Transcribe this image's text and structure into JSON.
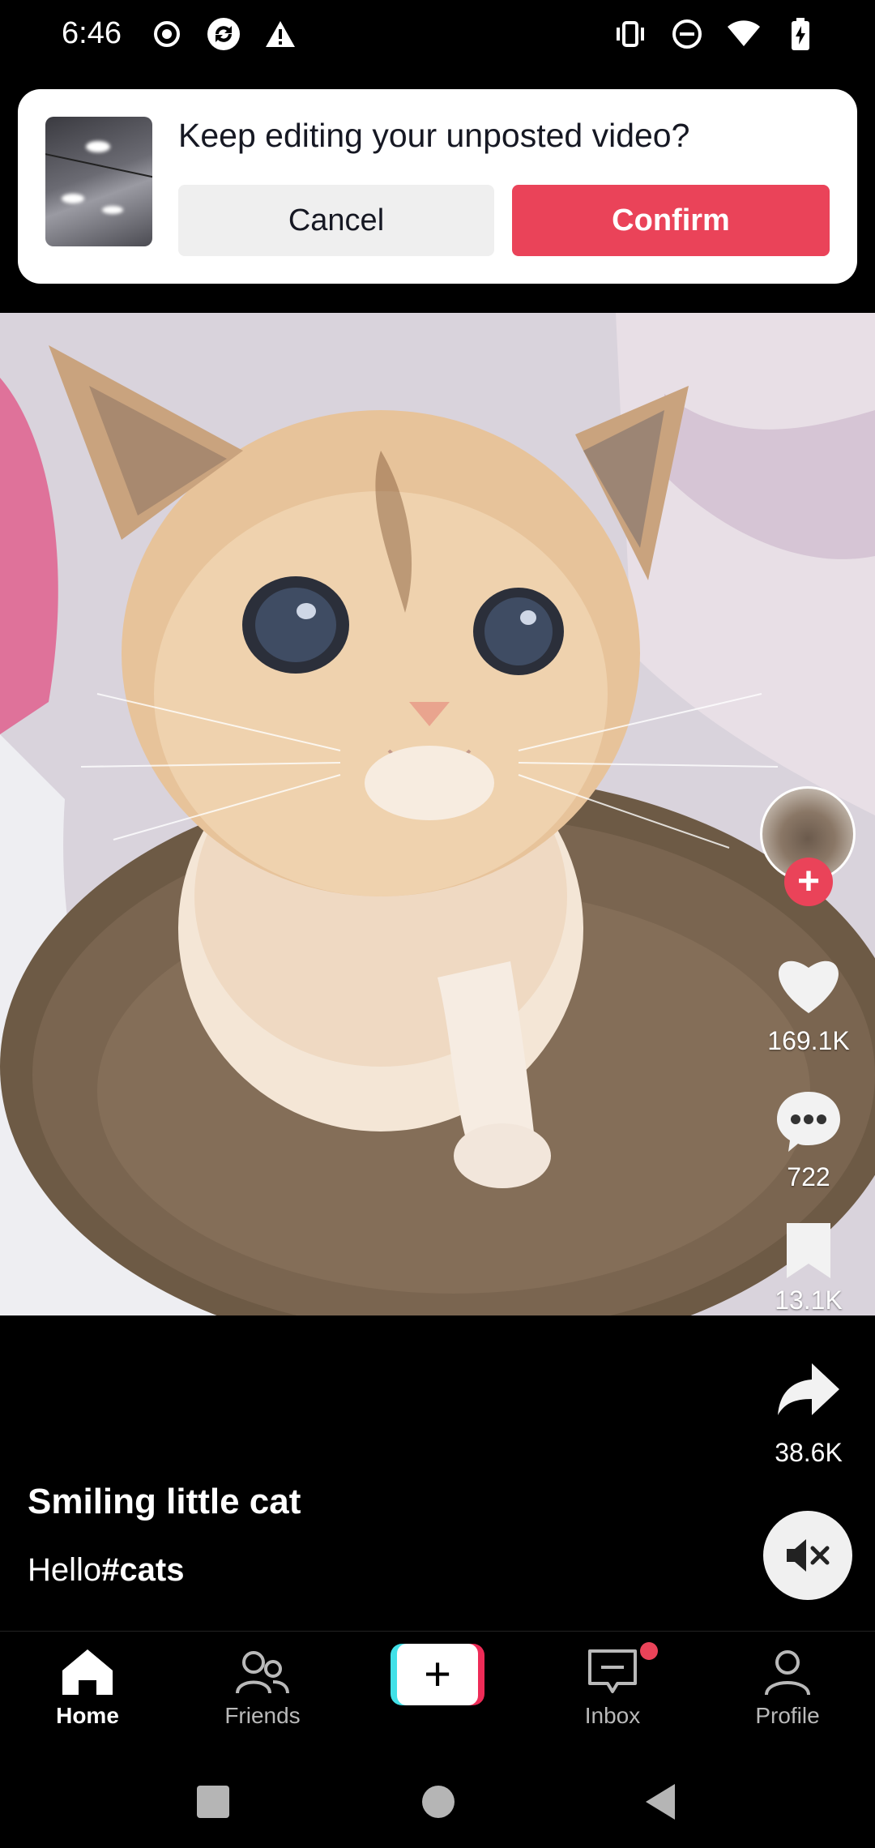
{
  "status_bar": {
    "time": "6:46",
    "left_icons": [
      "record-icon",
      "sync-icon",
      "warning-icon"
    ],
    "right_icons": [
      "vibrate-icon",
      "do-not-disturb-icon",
      "wifi-icon",
      "battery-charging-icon"
    ]
  },
  "draft_dialog": {
    "title": "Keep editing your unposted video?",
    "cancel_label": "Cancel",
    "confirm_label": "Confirm"
  },
  "video": {
    "subject": "kitten-image"
  },
  "actions": {
    "likes": "169.1K",
    "comments": "722",
    "saves": "13.1K",
    "shares": "38.6K"
  },
  "caption": {
    "title": "Smiling little cat",
    "text_plain": "Hello",
    "hashtag": "#cats"
  },
  "bottom_nav": {
    "items": [
      {
        "label": "Home",
        "icon": "home-icon"
      },
      {
        "label": "Friends",
        "icon": "friends-icon"
      },
      {
        "label": "",
        "icon": "create-plus-icon"
      },
      {
        "label": "Inbox",
        "icon": "inbox-icon"
      },
      {
        "label": "Profile",
        "icon": "profile-icon"
      }
    ]
  },
  "colors": {
    "accent": "#ea4359",
    "create_cyan": "#42e1e8",
    "create_red": "#ee2b57"
  }
}
